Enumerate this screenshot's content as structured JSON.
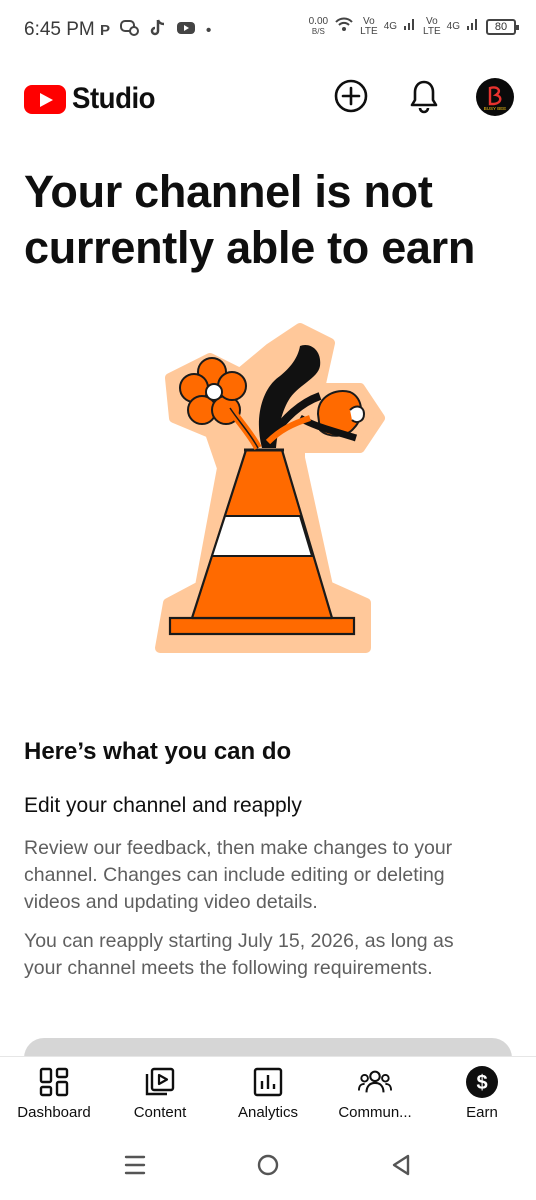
{
  "status_bar": {
    "time": "6:45 PM",
    "left_icons": [
      "P",
      "chat-icon",
      "tiktok-icon",
      "youtube-icon",
      "•"
    ],
    "network_speed_value": "0.00",
    "network_speed_unit": "B/S",
    "sim1_volte_top": "Vo",
    "sim1_volte_bottom": "LTE",
    "sim1_network": "4G",
    "sim2_volte_top": "Vo",
    "sim2_volte_bottom": "LTE",
    "sim2_network": "4G",
    "battery": "80"
  },
  "app_bar": {
    "logo_text": "Studio",
    "brand_color": "#ff0000",
    "create_icon": "add-circle-icon",
    "notifications_icon": "bell-icon",
    "avatar_text": "BUSY BEE"
  },
  "main": {
    "headline": "Your channel is not currently able to earn",
    "illustration": "traffic-cone-with-flowers",
    "section_title": "Here’s what you can do",
    "sub_title": "Edit your channel and reapply",
    "paragraph_1": "Review our feedback, then make changes to your channel. Changes can include editing or deleting videos and updating video details.",
    "paragraph_2": "You can reapply starting July 15, 2026, as long as your channel meets the following requirements."
  },
  "bottom_nav": {
    "items": [
      {
        "label": "Dashboard",
        "icon": "dashboard-icon"
      },
      {
        "label": "Content",
        "icon": "content-icon"
      },
      {
        "label": "Analytics",
        "icon": "analytics-icon"
      },
      {
        "label": "Commun...",
        "icon": "community-icon"
      },
      {
        "label": "Earn",
        "icon": "earn-icon"
      }
    ],
    "active": "Earn"
  },
  "system_nav": {
    "icons": [
      "menu-icon",
      "home-icon",
      "back-icon"
    ]
  }
}
